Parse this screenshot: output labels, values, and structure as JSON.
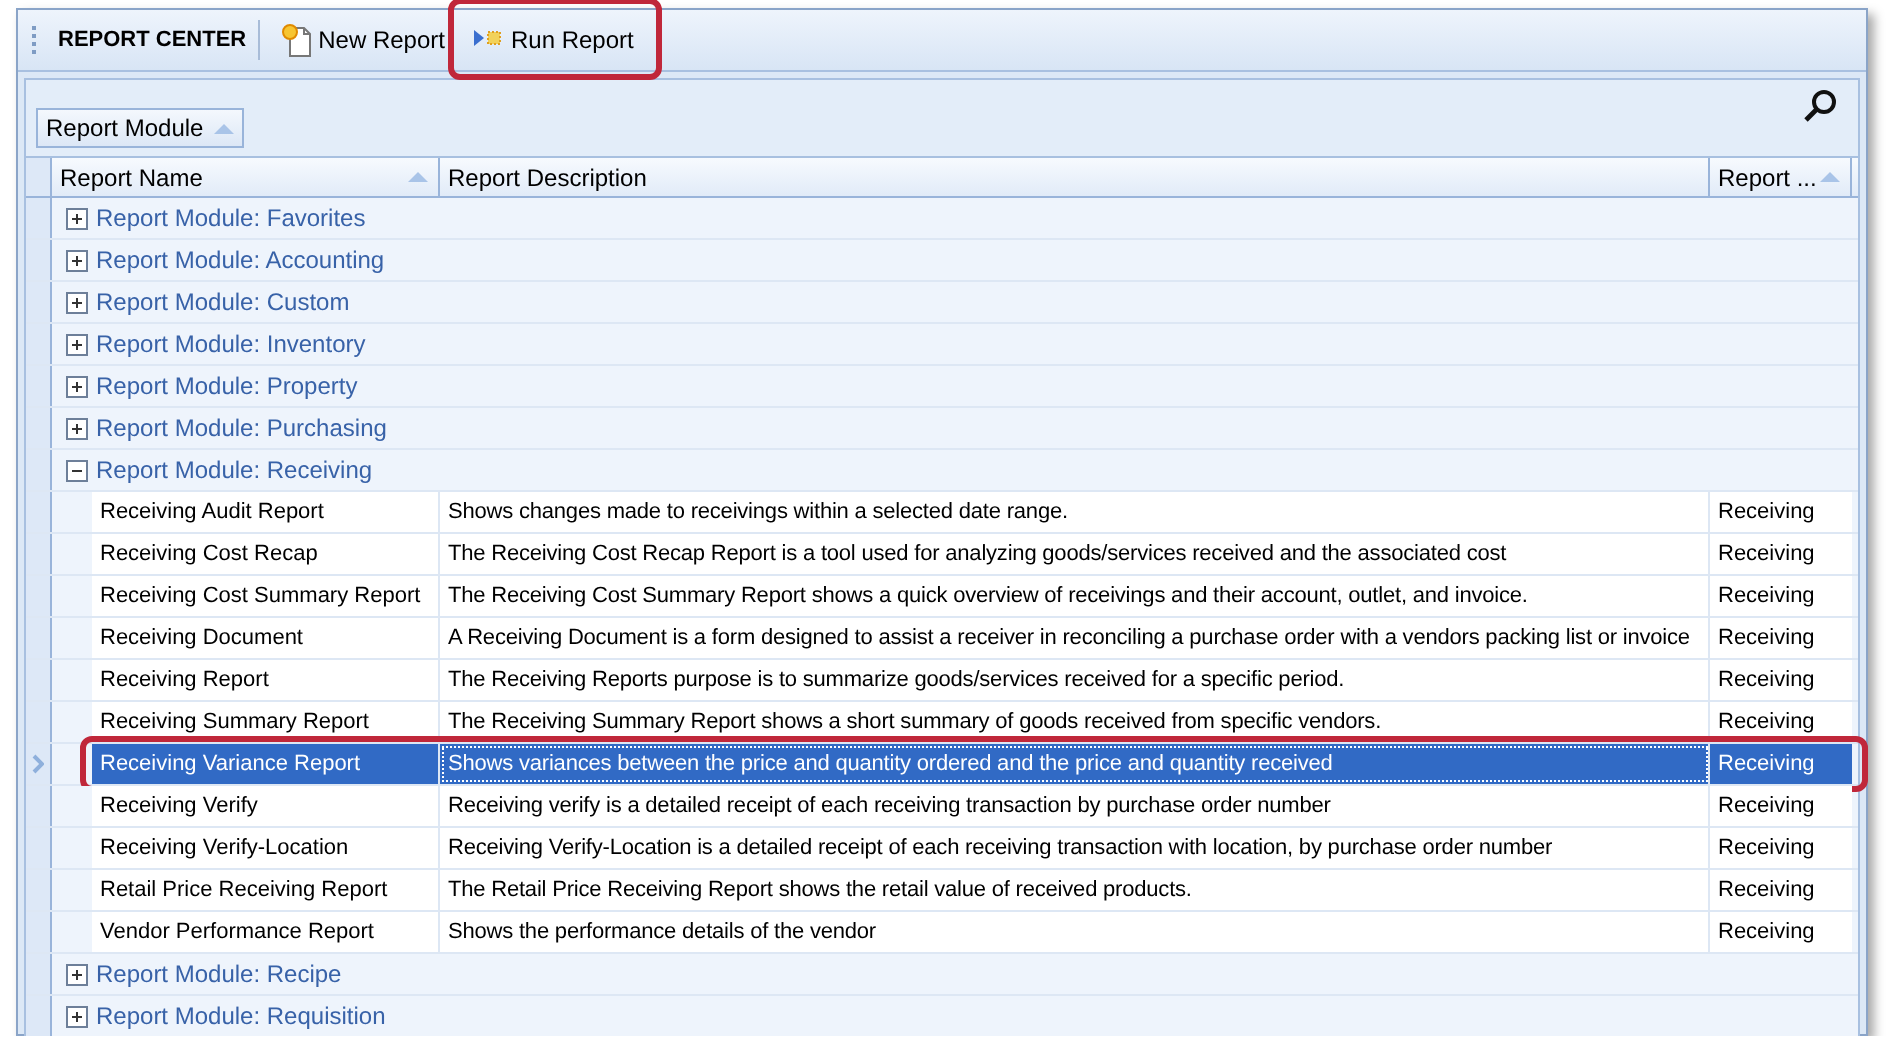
{
  "toolbar": {
    "title": "REPORT CENTER",
    "buttons": [
      {
        "kind": "new",
        "label": "New Report",
        "highlighted": false
      },
      {
        "kind": "run",
        "label": "Run Report",
        "highlighted": true
      }
    ]
  },
  "group_panel": {
    "chip": "Report Module"
  },
  "table": {
    "columns": [
      {
        "label": "Report Name",
        "sorted": true
      },
      {
        "label": "Report Description",
        "sorted": false
      },
      {
        "label": "Report ...",
        "sorted": true
      }
    ],
    "groups": [
      {
        "label": "Report Module: Favorites",
        "expanded": false
      },
      {
        "label": "Report Module: Accounting",
        "expanded": false
      },
      {
        "label": "Report Module: Custom",
        "expanded": false
      },
      {
        "label": "Report Module: Inventory",
        "expanded": false
      },
      {
        "label": "Report Module: Property",
        "expanded": false
      },
      {
        "label": "Report Module: Purchasing",
        "expanded": false
      },
      {
        "label": "Report Module: Receiving",
        "expanded": true,
        "children": [
          {
            "name": "Receiving Audit Report",
            "description": "Shows changes made to receivings within a selected date range.",
            "module": "Receiving",
            "selected": false,
            "highlighted": false
          },
          {
            "name": "Receiving Cost Recap",
            "description": "The Receiving Cost Recap Report is a tool used for analyzing goods/services received and the associated cost",
            "module": "Receiving",
            "selected": false,
            "highlighted": false
          },
          {
            "name": "Receiving Cost Summary Report",
            "description": "The Receiving Cost Summary Report shows a quick overview of receivings and their account, outlet, and invoice.",
            "module": "Receiving",
            "selected": false,
            "highlighted": false
          },
          {
            "name": "Receiving Document",
            "description": "A Receiving Document is a form designed to assist a receiver in reconciling a purchase order with a vendors packing list or invoice",
            "module": "Receiving",
            "selected": false,
            "highlighted": false
          },
          {
            "name": "Receiving Report",
            "description": "The Receiving Reports purpose is to summarize goods/services received for a specific period.",
            "module": "Receiving",
            "selected": false,
            "highlighted": false
          },
          {
            "name": "Receiving Summary Report",
            "description": "The Receiving Summary Report shows a short summary of goods received from specific vendors.",
            "module": "Receiving",
            "selected": false,
            "highlighted": false
          },
          {
            "name": "Receiving Variance Report",
            "description": "Shows variances between the price and quantity ordered and the price and quantity received",
            "module": "Receiving",
            "selected": true,
            "highlighted": true
          },
          {
            "name": "Receiving Verify",
            "description": "Receiving verify is a detailed receipt of each receiving transaction by purchase order number",
            "module": "Receiving",
            "selected": false,
            "highlighted": false
          },
          {
            "name": "Receiving Verify-Location",
            "description": "Receiving Verify-Location is a detailed receipt of each receiving transaction with location, by purchase order number",
            "module": "Receiving",
            "selected": false,
            "highlighted": false
          },
          {
            "name": "Retail Price Receiving Report",
            "description": "The Retail Price Receiving Report shows the retail value of received products.",
            "module": "Receiving",
            "selected": false,
            "highlighted": false
          },
          {
            "name": "Vendor Performance Report",
            "description": "Shows the performance details of the vendor",
            "module": "Receiving",
            "selected": false,
            "highlighted": false
          }
        ]
      },
      {
        "label": "Report Module: Recipe",
        "expanded": false
      },
      {
        "label": "Report Module: Requisition",
        "expanded": false
      }
    ]
  }
}
